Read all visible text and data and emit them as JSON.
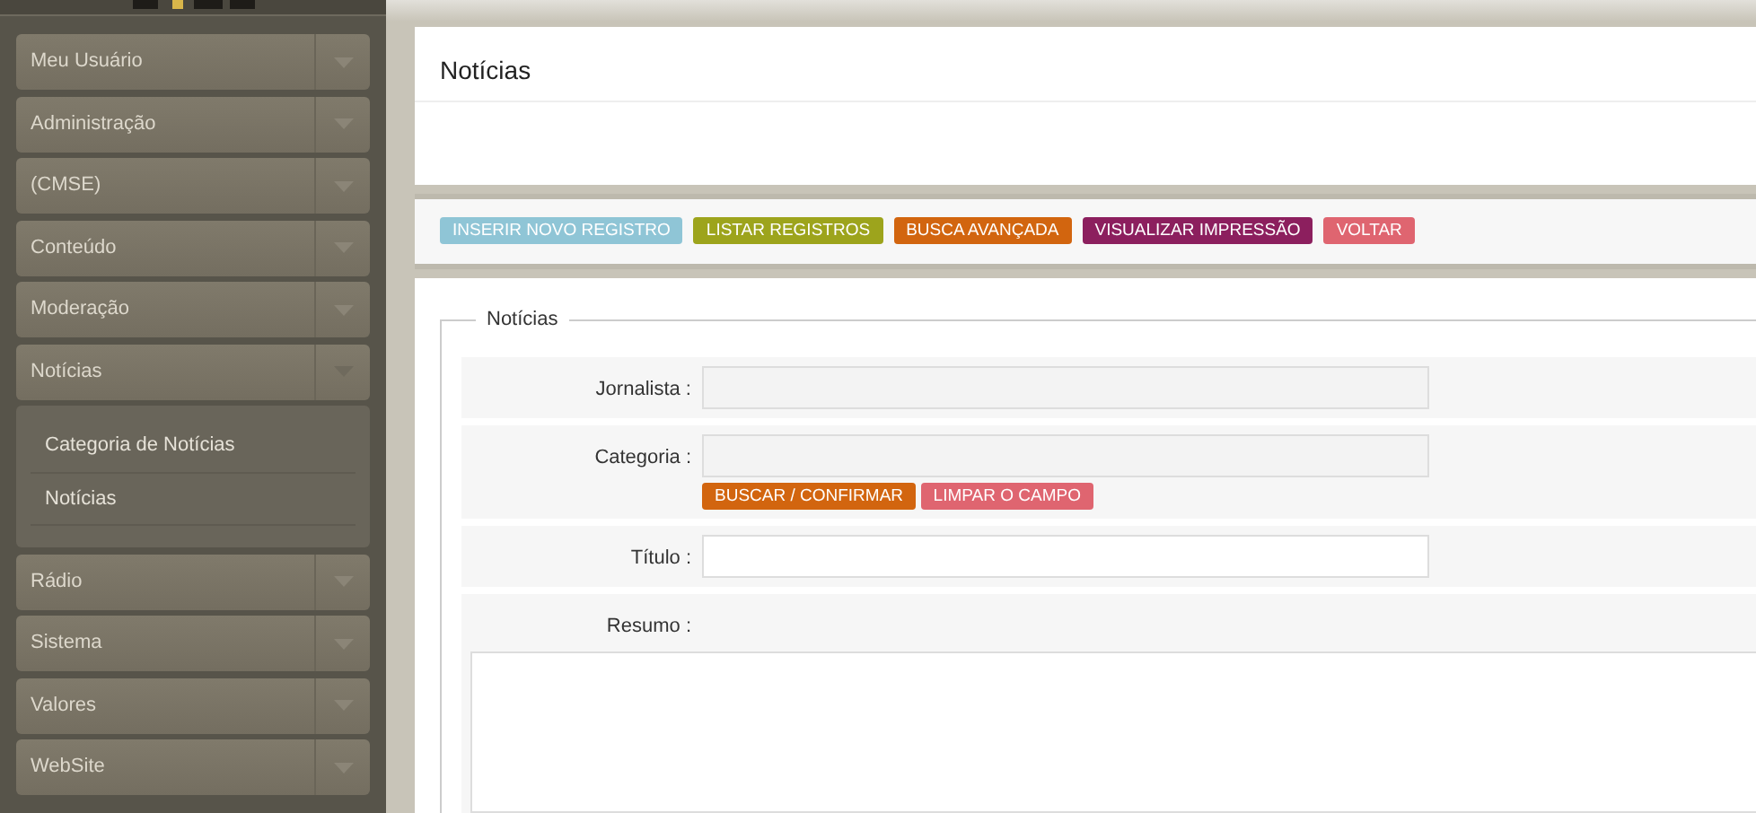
{
  "sidebar": {
    "items": [
      {
        "label": "Meu Usuário",
        "expanded": false
      },
      {
        "label": "Administração",
        "expanded": false
      },
      {
        "label": "(CMSE)",
        "expanded": false
      },
      {
        "label": "Conteúdo",
        "expanded": false
      },
      {
        "label": "Moderação",
        "expanded": false
      },
      {
        "label": "Notícias",
        "expanded": true,
        "children": [
          {
            "label": "Categoria de Notícias"
          },
          {
            "label": "Notícias"
          }
        ]
      },
      {
        "label": "Rádio",
        "expanded": false
      },
      {
        "label": "Sistema",
        "expanded": false
      },
      {
        "label": "Valores",
        "expanded": false
      },
      {
        "label": "WebSite",
        "expanded": false
      }
    ]
  },
  "page": {
    "title": "Notícias"
  },
  "toolbar": [
    {
      "label": "INSERIR NOVO REGISTRO",
      "color": "#8fc5d6"
    },
    {
      "label": "LISTAR REGISTROS",
      "color": "#9da41c"
    },
    {
      "label": "BUSCA AVANÇADA",
      "color": "#d2650f"
    },
    {
      "label": "VISUALIZAR IMPRESSÃO",
      "color": "#8c1f5e"
    },
    {
      "label": "VOLTAR",
      "color": "#df6570"
    }
  ],
  "form": {
    "legend": "Notícias",
    "fields": [
      {
        "kind": "input",
        "label": "Jornalista :",
        "disabled": true
      },
      {
        "kind": "lookup",
        "label": "Categoria :",
        "disabled": true,
        "buttons": [
          {
            "label": "BUSCAR / CONFIRMAR",
            "color": "#d2650f"
          },
          {
            "label": "LIMPAR O CAMPO",
            "color": "#df6570"
          }
        ]
      },
      {
        "kind": "input",
        "label": "Título :",
        "disabled": false
      },
      {
        "kind": "textarea",
        "label": "Resumo :",
        "disabled": false
      }
    ]
  }
}
